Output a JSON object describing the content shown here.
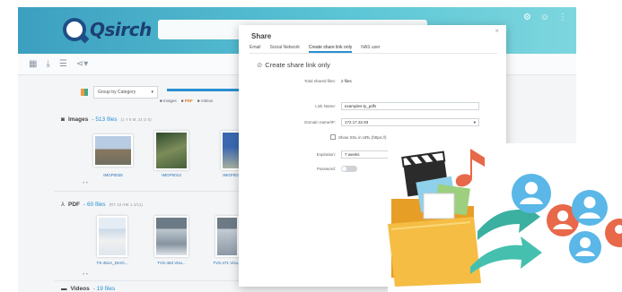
{
  "app": {
    "logo_text": "Qsirch",
    "toolbar_icons": [
      "grid-icon",
      "download-icon",
      "list-icon",
      "share-icon"
    ]
  },
  "filter": {
    "group_by": "Group by Category"
  },
  "chips": [
    {
      "label": "Images",
      "value": ""
    },
    {
      "label": "PDF",
      "value": ""
    },
    {
      "label": "Videos",
      "value": ""
    }
  ],
  "sections": {
    "images": {
      "name": "Images",
      "count": "- 513 files",
      "date": "(1 Y 6 M, 21 D 5)"
    },
    "pdf": {
      "name": "PDF",
      "count": "- 60 files",
      "date": "(RT 10 /HE 1 2/11)"
    },
    "videos": {
      "name": "Videos",
      "count": "- 19 files"
    }
  },
  "images": [
    {
      "label": "IMGP0025"
    },
    {
      "label": "IMGP0013"
    },
    {
      "label": "IMGP0018"
    }
  ],
  "pdfs": [
    {
      "label": "TS-451A_DIAG..."
    },
    {
      "label": "TVS-463 Visu..."
    },
    {
      "label": "TVS-471 Visu..."
    }
  ],
  "dialog": {
    "title": "Share",
    "close": "×",
    "tabs": [
      "Email",
      "Social Network",
      "Create share link only",
      "NAS user"
    ],
    "active_tab_index": 2,
    "create_link_label": "Create share link only",
    "rows": {
      "total_shared": {
        "label": "Total shared files:",
        "value": "2 files"
      },
      "link_name": {
        "label": "Link Name:",
        "value": "examples-ty_pdfs"
      },
      "domain": {
        "label": "Domain name/IP:",
        "value": "172.17.32.93"
      },
      "ssl": {
        "label": "Show SSL in URL (https://)"
      },
      "expiration": {
        "label": "Expiration:",
        "value": "7 weeks"
      },
      "password": {
        "label": "Password:"
      }
    }
  },
  "colors": {
    "header": "#4fb6cc",
    "accent": "#2a8fd0",
    "folder": "#f2b73a",
    "arrow": "#3bb0a0",
    "people_blue": "#5ab7e8",
    "people_red": "#e8684a"
  }
}
